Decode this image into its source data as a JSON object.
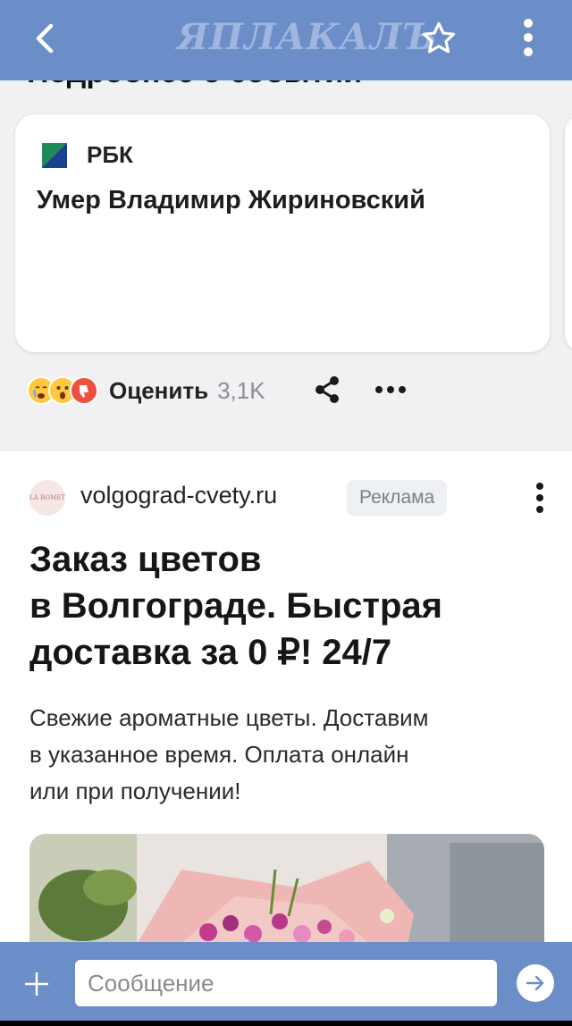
{
  "topbar": {
    "logo_text": "ЯПЛАКАЛЪ",
    "back_icon": "chevron-left-icon",
    "star_icon": "star-outline-icon",
    "more_icon": "vertical-dots-icon",
    "bar_color": "#6b8ec9"
  },
  "feed": {
    "cut_heading": "Подробнее о событии",
    "news_card": {
      "source": "РБК",
      "title": "Умер Владимир Жириновский"
    },
    "reactions": {
      "emojis": [
        "crying-face-icon",
        "surprised-face-icon",
        "thumbs-down-icon"
      ],
      "rate_label": "Оценить",
      "count": "3,1K",
      "share_icon": "share-icon",
      "more_icon": "horizontal-dots-icon"
    }
  },
  "ad": {
    "avatar_text": "LA BOMET",
    "domain": "volgograd-cvety.ru",
    "badge": "Реклама",
    "title_line1": "Заказ цветов",
    "title_line2": "в Волгограде. Быстрая",
    "title_line3": "доставка за 0 ₽! 24/7",
    "desc_line1": "Свежие ароматные цветы. Доставим",
    "desc_line2": "в указанное время. Оплата онлайн",
    "desc_line3": "или при получении!"
  },
  "composer": {
    "placeholder": "Сообщение",
    "plus_icon": "plus-icon",
    "send_icon": "arrow-right-icon"
  }
}
